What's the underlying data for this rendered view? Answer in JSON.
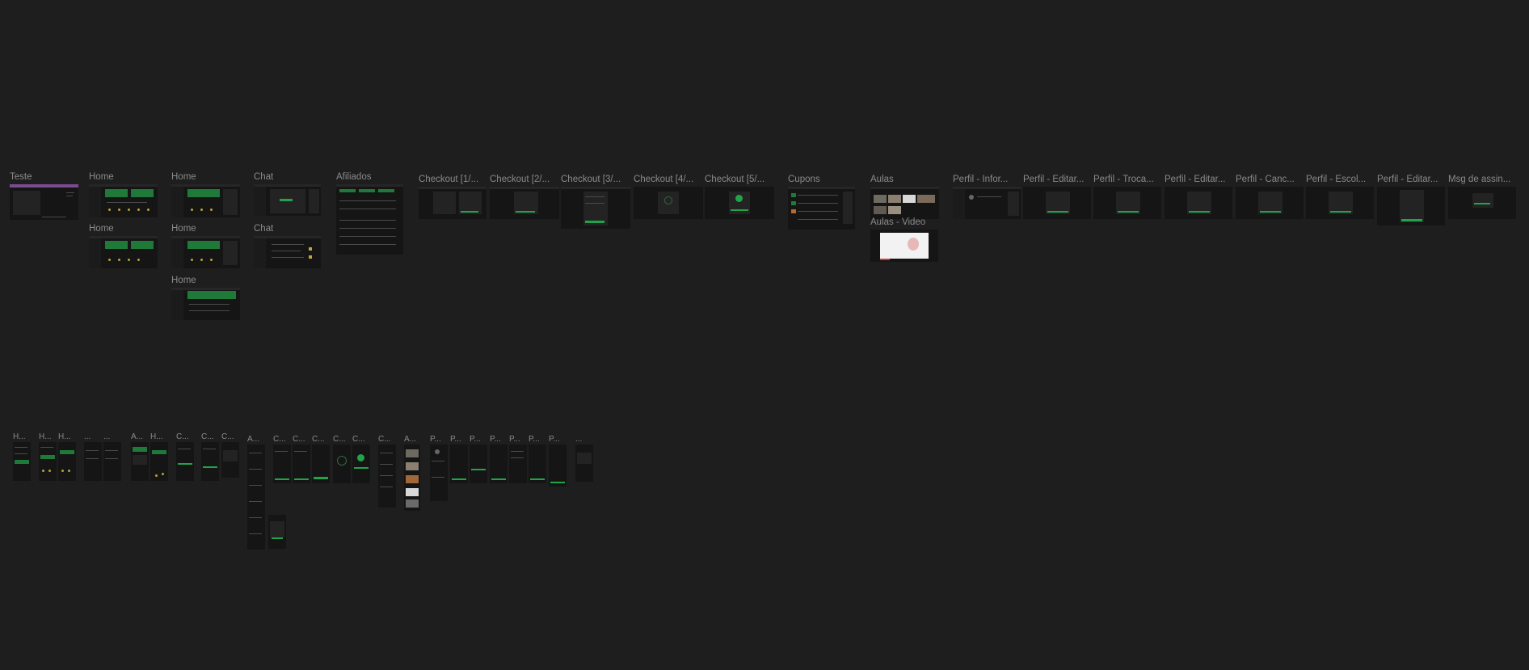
{
  "canvas": {
    "background": "#1e1e1e",
    "accent_green": "#22a34a",
    "label_color": "#8a8a8a"
  },
  "frames_row1": [
    "Teste",
    "Home",
    "Home",
    "Chat",
    "Afiliados",
    "Checkout [1/...",
    "Checkout [2/...",
    "Checkout [3/...",
    "Checkout [4/...",
    "Checkout [5/...",
    "Cupons",
    "Aulas",
    "Perfil - Infor...",
    "Perfil - Editar...",
    "Perfil - Troca...",
    "Perfil - Editar...",
    "Perfil - Canc...",
    "Perfil - Escol...",
    "Perfil - Editar...",
    "Msg de assin..."
  ],
  "frames_row2": [
    "Home",
    "Home",
    "Chat",
    "Aulas - Video"
  ],
  "frames_row3": [
    "Home"
  ],
  "mobile_frames": [
    "H...",
    "H...",
    "H...",
    "...",
    "...",
    "A...",
    "H...",
    "C...",
    "C...",
    "C...",
    "A...",
    "C...",
    "C...",
    "C...",
    "C...",
    "C...",
    "C...",
    "A...",
    "P...",
    "P...",
    "P...",
    "P...",
    "P...",
    "P...",
    "P...",
    "..."
  ]
}
